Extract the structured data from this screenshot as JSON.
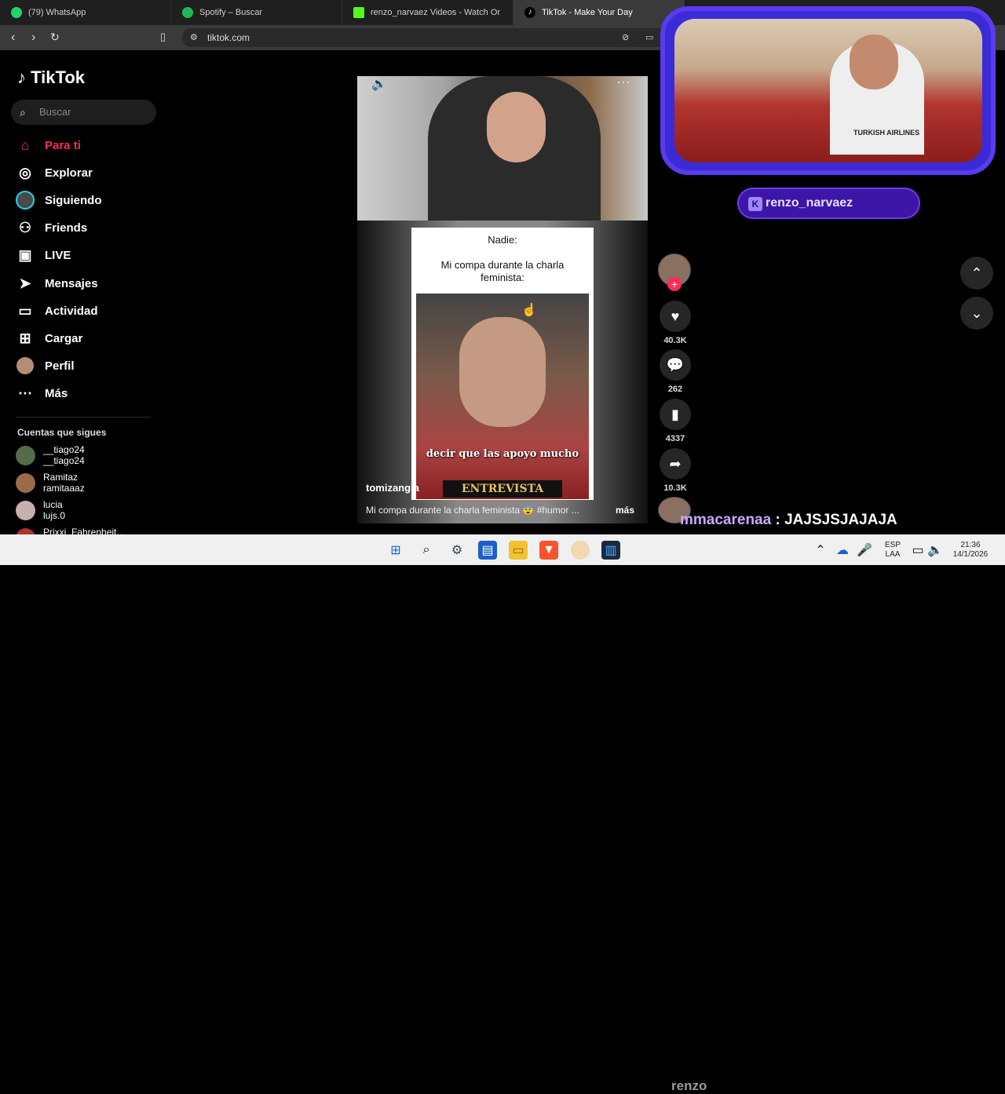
{
  "browser": {
    "tabs": [
      {
        "label": "(79) WhatsApp",
        "icon": "whatsapp-icon",
        "color": "#25d366"
      },
      {
        "label": "Spotify – Buscar",
        "icon": "spotify-icon",
        "color": "#1db954"
      },
      {
        "label": "renzo_narvaez Videos - Watch Or",
        "icon": "kick-icon",
        "color": "#53fc18"
      },
      {
        "label": "TikTok - Make Your Day",
        "icon": "tiktok-icon",
        "color": "#ffffff"
      }
    ],
    "url": "tiktok.com"
  },
  "sidebar": {
    "logo": "TikTok",
    "search_placeholder": "Buscar",
    "nav": [
      {
        "label": "Para ti",
        "icon": "home-icon",
        "active": true
      },
      {
        "label": "Explorar",
        "icon": "compass-icon"
      },
      {
        "label": "Siguiendo",
        "icon": "following-avatar-icon"
      },
      {
        "label": "Friends",
        "icon": "friends-icon"
      },
      {
        "label": "LIVE",
        "icon": "live-icon"
      },
      {
        "label": "Mensajes",
        "icon": "send-icon"
      },
      {
        "label": "Actividad",
        "icon": "activity-icon"
      },
      {
        "label": "Cargar",
        "icon": "upload-icon"
      },
      {
        "label": "Perfil",
        "icon": "profile-avatar-icon"
      },
      {
        "label": "Más",
        "icon": "more-dots-icon"
      }
    ],
    "following_title": "Cuentas que sigues",
    "following": [
      {
        "name": "__tiago24",
        "handle": "__tiago24"
      },
      {
        "name": "Ramitaz",
        "handle": "ramitaaaz"
      },
      {
        "name": "lucia",
        "handle": "lujs.0"
      },
      {
        "name": "Prixxi_Fahrenheit...",
        "handle": ""
      }
    ]
  },
  "video": {
    "meme_line1": "Nadie:",
    "meme_line2": "Mi compa durante la charla feminista:",
    "caption": "decir que las apoyo mucho",
    "brand": "ENTREVISTA",
    "username": "tomizangla",
    "description": "Mi compa durante la charla feminista 😨 #humor ...",
    "more": "más"
  },
  "actions": {
    "likes": "40.3K",
    "comments": "262",
    "saves": "4337",
    "shares": "10.3K"
  },
  "stream": {
    "channel": "renzo_narvaez",
    "jersey_text": "TURKISH AIRLINES",
    "chat_user": "mmacarenaa",
    "chat_message": "JAJSJSJAJAJA",
    "overlay_name": "renzo"
  },
  "taskbar": {
    "lang1": "ESP",
    "lang2": "LAA",
    "time": "21:36",
    "date": "14/1/2026"
  }
}
